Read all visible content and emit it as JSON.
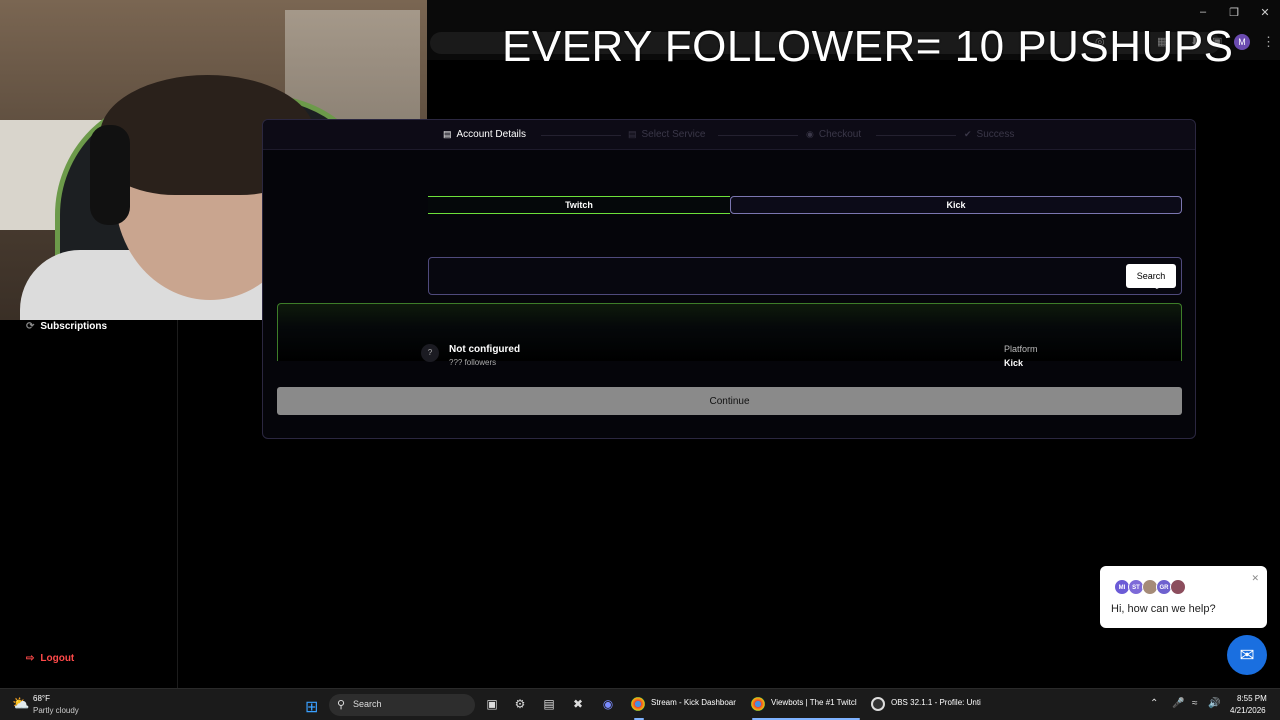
{
  "overlay": {
    "banner": "EVERY FOLLOWER= 10 PUSHUPS"
  },
  "browser": {
    "profile_initial": "M"
  },
  "wizard": {
    "steps": [
      {
        "label": "Account Details"
      },
      {
        "label": "Select Service"
      },
      {
        "label": "Checkout"
      },
      {
        "label": "Success"
      }
    ],
    "tabs": {
      "twitch": "Twitch",
      "kick": "Kick"
    },
    "search_button": "Search",
    "result": {
      "avatar": "?",
      "name": "Not configured",
      "followers": "??? followers",
      "platform_label": "Platform",
      "platform_value": "Kick"
    },
    "continue_button": "Continue"
  },
  "sidebar": {
    "subscriptions": "Subscriptions",
    "logout": "Logout"
  },
  "chat": {
    "avatars": [
      "MI",
      "ST",
      "",
      "GR",
      ""
    ],
    "message": "Hi, how can we help?"
  },
  "taskbar": {
    "weather_temp": "68°F",
    "weather_desc": "Partly cloudy",
    "search_label": "Search",
    "apps": [
      {
        "label": "Stream - Kick Dashboar"
      },
      {
        "label": "Viewbots | The #1 Twitcl"
      },
      {
        "label": "OBS 32.1.1 - Profile: Unti"
      }
    ],
    "clock_time": "8:55 PM",
    "clock_date": "4/21/2026"
  },
  "colors": {
    "kick_green": "#6de03a",
    "accent_purple": "#7b76b0",
    "logout_red": "#ff4a4a",
    "chat_blue": "#1a6fe0"
  }
}
